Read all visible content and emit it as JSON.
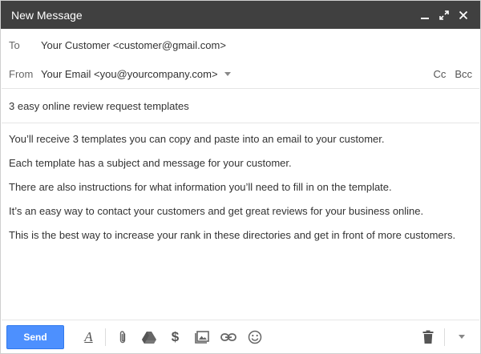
{
  "window": {
    "title": "New Message",
    "controls": {
      "minimize": "minimize-icon",
      "expand": "expand-icon",
      "close": "close-icon"
    }
  },
  "header": {
    "to_label": "To",
    "to_value": "Your Customer <customer@gmail.com>",
    "from_label": "From",
    "from_value": "Your Email <you@yourcompany.com>",
    "cc_label": "Cc",
    "bcc_label": "Bcc"
  },
  "subject": "3 easy online review request templates",
  "body": {
    "paragraphs": [
      "You’ll receive 3 templates you can copy and paste into an email to your customer.",
      "Each template has a subject and message for your customer.",
      "There are also instructions for what information you’ll need to fill in on the template.",
      "It’s an easy way to contact your customers and get great reviews for your business online.",
      "This is the best way to increase your rank in these directories and get in front of more customers."
    ]
  },
  "toolbar": {
    "send_label": "Send",
    "format_label": "A",
    "money_label": "$",
    "icons": [
      "format-text-icon",
      "attach-icon",
      "drive-icon",
      "money-icon",
      "photo-icon",
      "link-icon",
      "emoji-icon",
      "trash-icon",
      "more-options-icon"
    ]
  },
  "colors": {
    "titlebar": "#404040",
    "send_button": "#4d90fe"
  }
}
